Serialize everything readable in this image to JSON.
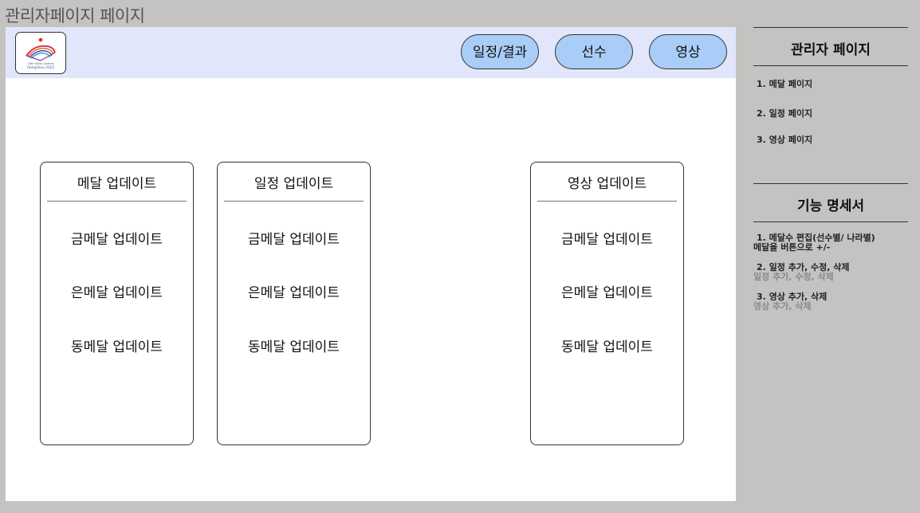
{
  "page": {
    "title": "관리자페이지 페이지"
  },
  "header": {
    "logo_text": "19th Asian Games Hangzhou 2022",
    "nav": [
      "일정/결과",
      "선수",
      "영상"
    ]
  },
  "cards": [
    {
      "title": "메달 업데이트",
      "items": [
        "금메달 업데이트",
        "은메달 업데이트",
        "동메달 업데이트"
      ]
    },
    {
      "title": "일정 업데이트",
      "items": [
        "금메달 업데이트",
        "은메달 업데이트",
        "동메달 업데이트"
      ]
    },
    {
      "title": "영상 업데이트",
      "items": [
        "금메달 업데이트",
        "은메달 업데이트",
        "동메달 업데이트"
      ]
    }
  ],
  "sidebar": {
    "admin_heading": "관리자 페이지",
    "admin_links": [
      "1. 메달 페이지",
      "2. 일정 페이지",
      "3. 영상 페이지"
    ],
    "spec_heading": "기능 명세서",
    "specs": [
      {
        "title": "1. 메달수 편집(선수별/ 나라별)",
        "desc": "메달을 버튼으로 +/-"
      },
      {
        "title": "2. 일정 추가, 수정, 삭제",
        "desc": "일정 추가, 수정, 삭제"
      },
      {
        "title": "3. 영상 추가, 삭제",
        "desc": "영상 추가, 삭제"
      }
    ]
  },
  "colors": {
    "background": "#c4c3c1",
    "topbar": "#e1e6fb",
    "nav_button": "#a9cdf6"
  }
}
